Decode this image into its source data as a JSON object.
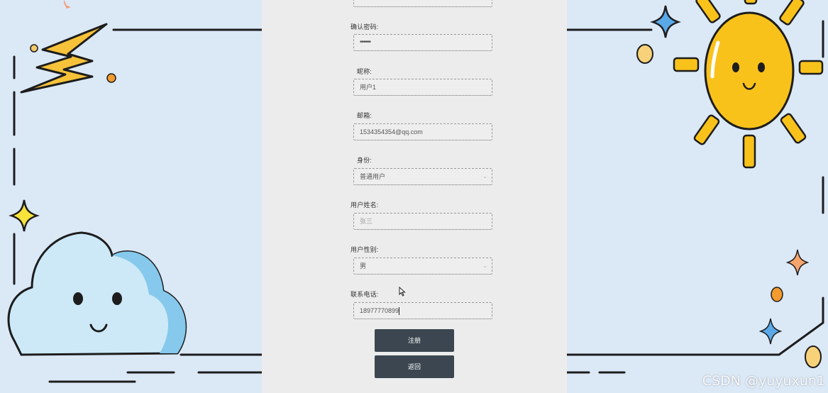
{
  "form": {
    "confirm_password": {
      "label": "确认密码:",
      "value": "••••••"
    },
    "nickname": {
      "label": "昵称:",
      "value": "用户1"
    },
    "email": {
      "label": "邮箱:",
      "value": "1534354354@qq.com"
    },
    "identity": {
      "label": "身份:",
      "value": "普通用户"
    },
    "real_name": {
      "label": "用户姓名:",
      "placeholder": "张三"
    },
    "gender": {
      "label": "用户性别:",
      "value": "男"
    },
    "phone": {
      "label": "联系电话:",
      "value": "18977770899"
    }
  },
  "buttons": {
    "register": "注册",
    "back": "返回"
  },
  "watermark": "CSDN @yuyuxun1",
  "colors": {
    "button_bg": "#3b4650",
    "panel_bg": "#ececec",
    "page_bg": "#dbe8f6",
    "sun": "#f9c21b",
    "cloud": "#cde9f8"
  }
}
